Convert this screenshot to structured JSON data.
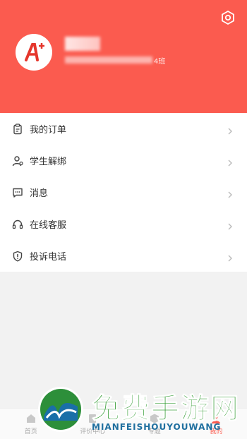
{
  "header": {
    "settings_icon": "gear-icon",
    "avatar_logo": "A+",
    "user_sub_tail": "4班"
  },
  "menu": {
    "items": [
      {
        "label": "我的订单",
        "icon": "clipboard-icon"
      },
      {
        "label": "学生解绑",
        "icon": "user-icon"
      },
      {
        "label": "消息",
        "icon": "message-icon"
      },
      {
        "label": "在线客服",
        "icon": "headset-icon"
      },
      {
        "label": "投诉电话",
        "icon": "alert-icon"
      }
    ]
  },
  "bottom_nav": {
    "items": [
      {
        "label": "首页",
        "active": false
      },
      {
        "label": "评价中心",
        "active": false
      },
      {
        "label": "专题",
        "active": false
      },
      {
        "label": "我的",
        "active": true
      }
    ]
  },
  "watermark": {
    "title": "免费手游网",
    "subtitle": "MIANFEISHOUYOUWANG"
  },
  "colors": {
    "accent": "#fb5b4f",
    "watermark_green": "#2f9a2f"
  }
}
